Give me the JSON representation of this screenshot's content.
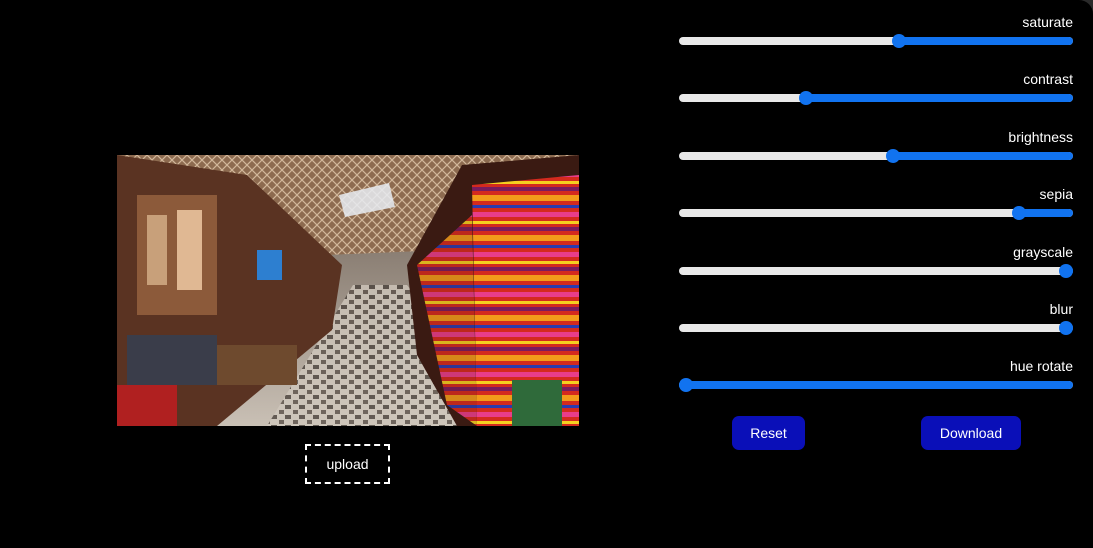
{
  "image": {
    "subject": "market-street-photo"
  },
  "upload": {
    "label": "upload"
  },
  "filters": [
    {
      "id": "saturate",
      "label": "saturate",
      "value": 0.56
    },
    {
      "id": "contrast",
      "label": "contrast",
      "value": 0.315
    },
    {
      "id": "brightness",
      "label": "brightness",
      "value": 0.545
    },
    {
      "id": "sepia",
      "label": "sepia",
      "value": 0.875
    },
    {
      "id": "grayscale",
      "label": "grayscale",
      "value": 1.0
    },
    {
      "id": "blur",
      "label": "blur",
      "value": 1.0
    },
    {
      "id": "hue-rotate",
      "label": "hue rotate",
      "value": 0.0
    }
  ],
  "actions": {
    "reset_label": "Reset",
    "download_label": "Download"
  },
  "colors": {
    "slider_accent": "#1173f0",
    "slider_track": "#e8e8e8",
    "button_bg": "#0a0fb8",
    "background": "#000000"
  }
}
